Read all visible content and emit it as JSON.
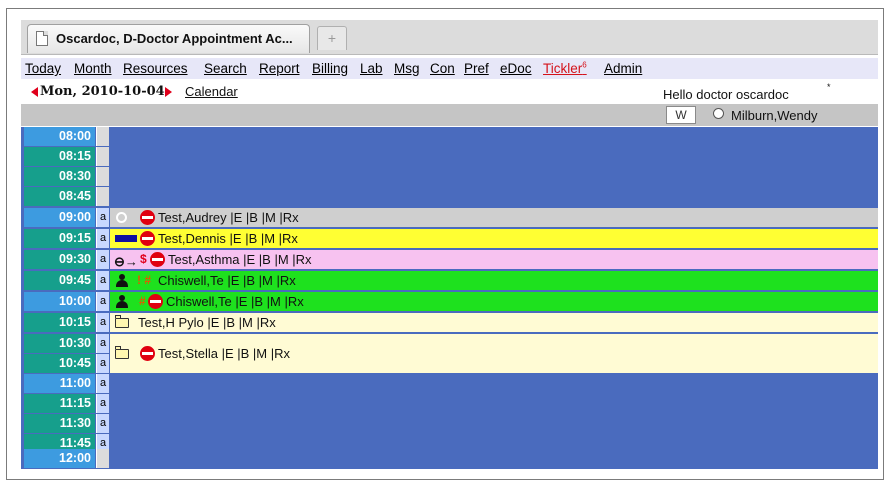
{
  "browser": {
    "tab_title": "Oscardoc, D-Doctor Appointment Ac...",
    "new_tab": "+"
  },
  "menu": {
    "items": [
      "Today",
      "Month",
      "Resources",
      "Search",
      "Report",
      "Billing",
      "Lab",
      "Msg",
      "Con",
      "Pref",
      "eDoc",
      "Tickler",
      "Admin"
    ],
    "tickler_count": "6"
  },
  "header": {
    "date": "Mon, 2010-10-04",
    "calendar_link": "Calendar",
    "greeting": "Hello doctor oscardoc",
    "greeting_mark": "*",
    "week_button": "W",
    "provider": "Milburn,Wendy"
  },
  "colors": {
    "grid": "#4a6bbe",
    "time_dark": "#169f8c",
    "time_light": "#3d9be0",
    "gray": "#cfcfcf",
    "yellow": "#ffff33",
    "pink": "#f7c2f0",
    "green": "#1ee11e",
    "cream": "#fffbd4",
    "tickler": "#d4121a"
  },
  "schedule": {
    "slot_marker": "a",
    "times": [
      "08:00",
      "08:15",
      "08:30",
      "08:45",
      "09:00",
      "09:15",
      "09:30",
      "09:45",
      "10:00",
      "10:15",
      "10:30",
      "10:45",
      "11:00",
      "11:15",
      "11:30",
      "11:45",
      "12:00"
    ],
    "appointments": [
      {
        "time": "09:00",
        "text": "Test,Audrey |E |B |M |Rx",
        "color": "gray",
        "icons": [
          "circle-icon",
          "no-show-icon"
        ]
      },
      {
        "time": "09:15",
        "text": "Test,Dennis |E |B |M |Rx",
        "color": "yellow",
        "icons": [
          "blue-bar-icon",
          "no-show-icon"
        ]
      },
      {
        "time": "09:30",
        "text": "Test,Asthma |E |B |M |Rx",
        "color": "pink",
        "icons": [
          "key-icon",
          "dollar-icon",
          "no-show-icon"
        ],
        "symbols": "$"
      },
      {
        "time": "09:45",
        "text": "Chiswell,Te |E |B |M |Rx",
        "color": "green",
        "icons": [
          "person-icon",
          "exclamation-icon"
        ],
        "symbols": "! #"
      },
      {
        "time": "10:00",
        "text": "Chiswell,Te |E |B |M |Rx",
        "color": "green",
        "icons": [
          "person-icon",
          "hash-icon",
          "no-show-icon"
        ],
        "symbols": "#"
      },
      {
        "time": "10:15",
        "text": "Test,H Pylo |E |B |M |Rx",
        "color": "cream",
        "icons": [
          "folder-icon"
        ]
      },
      {
        "time": "10:30",
        "text": "Test,Stella |E |B |M |Rx",
        "color": "cream",
        "icons": [
          "folder-icon",
          "no-show-icon"
        ]
      }
    ]
  }
}
